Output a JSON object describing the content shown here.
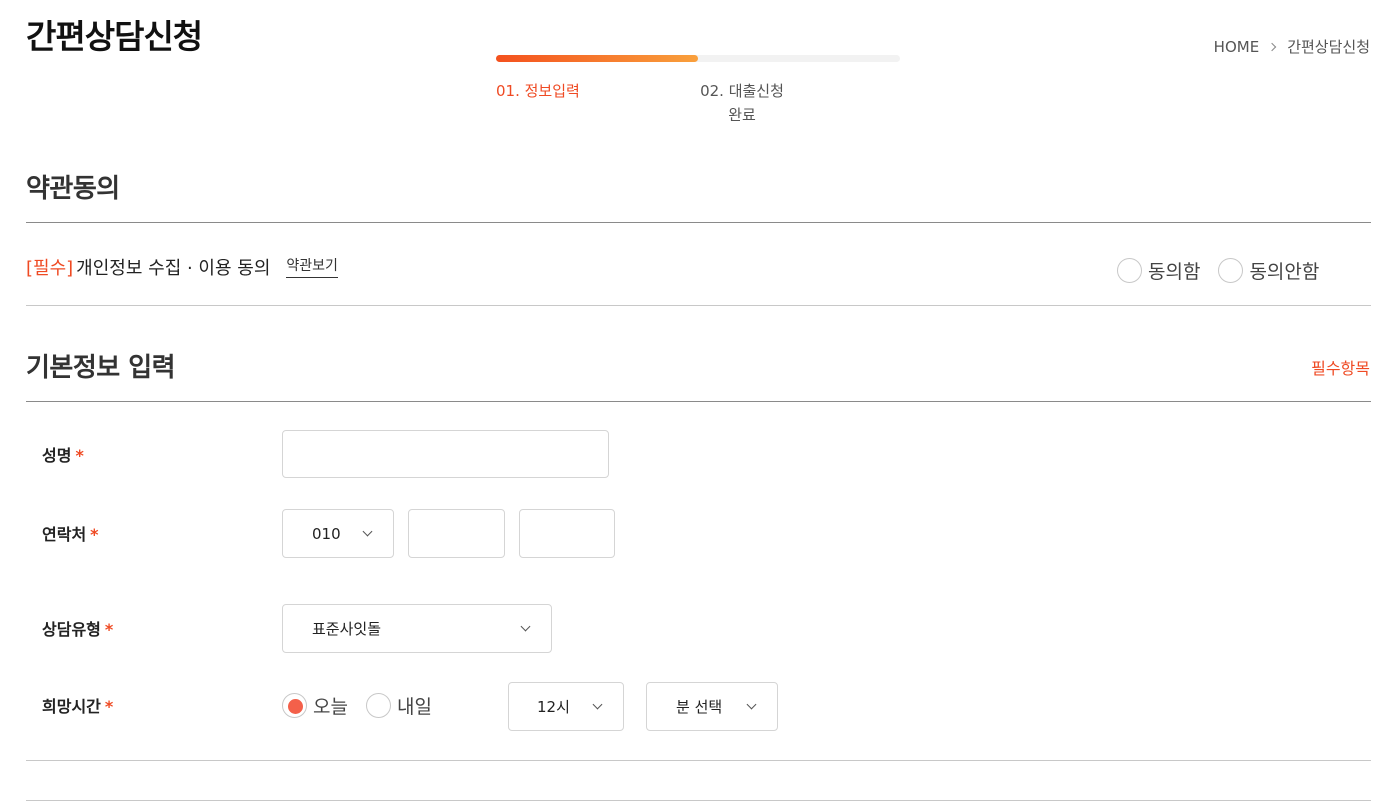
{
  "header": {
    "title": "간편상담신청",
    "breadcrumb": {
      "home": "HOME",
      "current": "간편상담신청"
    }
  },
  "progress": {
    "fraction": 0.5,
    "steps": [
      {
        "label": "01. 정보입력",
        "active": true
      },
      {
        "label_line1": "02. 대출신청",
        "label_line2": "완료",
        "active": false
      }
    ]
  },
  "terms": {
    "section_title": "약관동의",
    "required_tag": "[필수]",
    "item_label": "개인정보 수집 · 이용 동의",
    "view_link": "약관보기",
    "agree": "동의함",
    "disagree": "동의안함"
  },
  "basic": {
    "section_title": "기본정보 입력",
    "required_note": "필수항목",
    "star": "*",
    "name_label": "성명",
    "name_value": "",
    "phone_label": "연락처",
    "phone_prefix": "010",
    "phone_mid": "",
    "phone_last": "",
    "type_label": "상담유형",
    "type_value": "표준사잇돌",
    "time_label": "희망시간",
    "time_today": "오늘",
    "time_tomorrow": "내일",
    "hour_value": "12시",
    "minute_value": "분 선택"
  },
  "colors": {
    "accent": "#ef4a23",
    "progress_start": "#f4511e",
    "progress_end": "#f9a03c"
  }
}
